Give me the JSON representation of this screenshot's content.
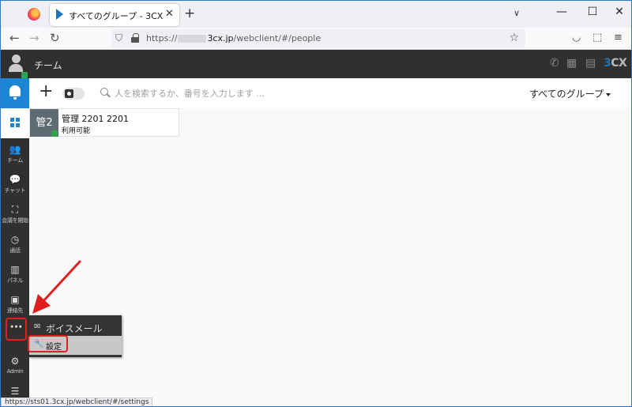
{
  "browser": {
    "tab_title": "すべてのグループ - 3CX",
    "tab_close": "✕",
    "new_tab": "+",
    "url_scheme": "https://",
    "url_host": "3cx.jp",
    "url_path": "/webclient/#/people",
    "status_url": "https://sts01.3cx.jp/webclient/#/settings",
    "window_controls": {
      "minimize": "—",
      "maximize": "☐",
      "close": "✕"
    },
    "icons": [
      "firefox-icon",
      "back-icon",
      "forward-icon",
      "reload-icon",
      "shield-icon",
      "lock-icon",
      "star-icon",
      "pocket-icon",
      "extensions-icon",
      "menu-icon"
    ]
  },
  "app": {
    "header_title": "チーム",
    "logo_text": "3CX",
    "logo_num": "3",
    "logo_rest": "CX",
    "colors": {
      "accent": "#1c86d4",
      "status_online": "#2ca54a",
      "dark": "#303030",
      "annotation": "#e02020"
    }
  },
  "sidebar": {
    "items": [
      {
        "label": "チーム",
        "icon": "team-icon"
      },
      {
        "label": "チャット",
        "icon": "chat-icon"
      },
      {
        "label": "会議を開始",
        "icon": "meeting-icon"
      },
      {
        "label": "通話",
        "icon": "history-icon"
      },
      {
        "label": "パネル",
        "icon": "panel-icon"
      },
      {
        "label": "連絡先",
        "icon": "contacts-icon"
      }
    ],
    "more": "···",
    "admin_label": "Admin"
  },
  "toolbar": {
    "add": "+",
    "search_placeholder": "人を検索するか、番号を入力します ...",
    "group_select": "すべてのグループ"
  },
  "contacts": [
    {
      "avatar": "管2",
      "name": "管理 2201 2201",
      "status": "利用可能"
    }
  ],
  "popup_menu": {
    "voicemail": "ボイスメール",
    "settings": "設定"
  }
}
